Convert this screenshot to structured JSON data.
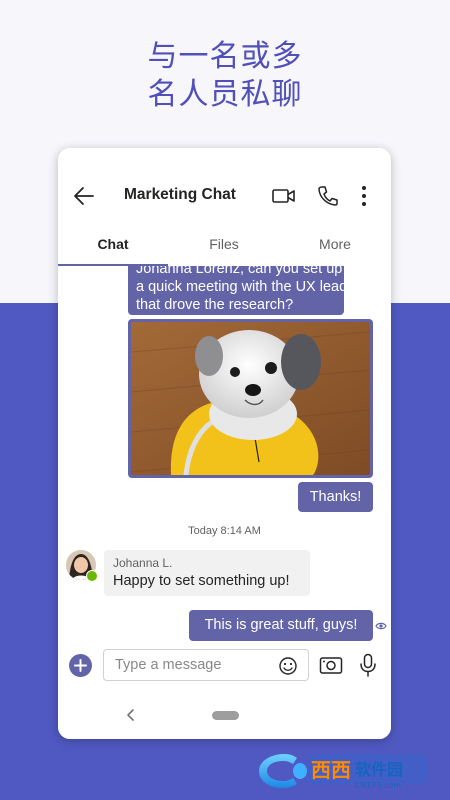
{
  "promo": {
    "line1": "与一名或多",
    "line2": "名人员私聊"
  },
  "header": {
    "title": "Marketing Chat",
    "icons": [
      "back-arrow-icon",
      "video-call-icon",
      "phone-icon",
      "more-options-icon"
    ]
  },
  "tabs": [
    {
      "label": "Chat",
      "active": true
    },
    {
      "label": "Files",
      "active": false
    },
    {
      "label": "More",
      "active": false
    }
  ],
  "messages": {
    "outgoing_1": [
      "Johanna Lorenz, can you set up",
      "a quick meeting with the UX lead",
      "that drove the research?"
    ],
    "thanks": "Thanks!",
    "timestamp": "Today 8:14 AM",
    "incoming": {
      "sender": "Johanna L.",
      "text": "Happy to set something up!"
    },
    "outgoing_2": "This is great stuff, guys!"
  },
  "compose": {
    "placeholder": "Type a message"
  },
  "watermark": {
    "brand": "西西软件园",
    "site": "CR173.com"
  },
  "colors": {
    "accent": "#6264a7",
    "promo_text": "#5050b8",
    "bottom_background": "#5059c2"
  }
}
